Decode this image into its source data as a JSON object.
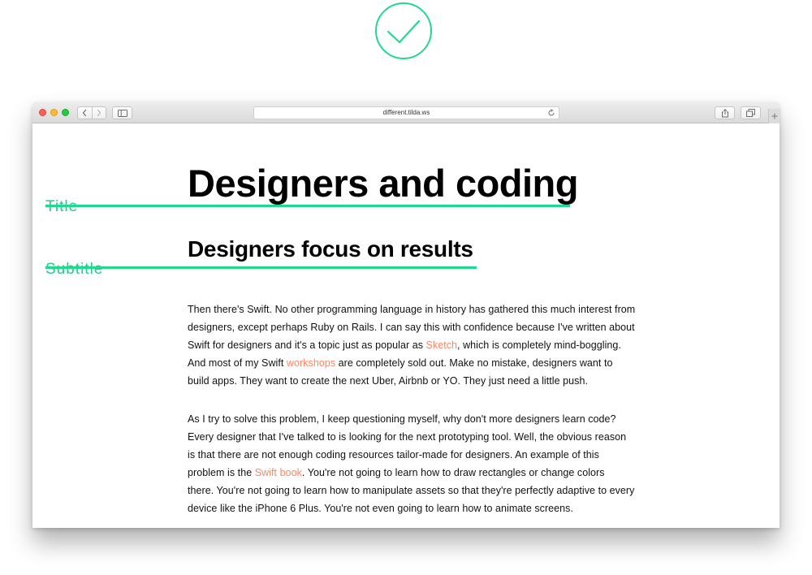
{
  "browser": {
    "url": "different.tilda.ws"
  },
  "page": {
    "title_label": "Title",
    "subtitle_label": "Subtitle",
    "title": "Designers and coding",
    "subtitle": "Designers focus on results",
    "paragraph1": {
      "line1": "Then there's Swift. No other programming language in history has gathered this much interest from",
      "line2": "designers, except perhaps Ruby on Rails. I can say this with confidence because I've written about",
      "line3_before": "Swift for designers and it's a topic just as popular as ",
      "line3_link": "Sketch",
      "line3_after": ", which is completely mind-boggling.",
      "line4_before": "And most of my Swift ",
      "line4_link": "workshops",
      "line4_after": " are completely sold out. Make no mistake, designers want to",
      "line5": "build apps. They want to create the next Uber, Airbnb or YO. They just need a little push."
    },
    "paragraph2": {
      "line1": "As I try to solve this problem, I keep questioning myself, why don't more designers learn code?",
      "line2": "Every designer that I've talked to is looking for the next prototyping tool. Well, the obvious reason",
      "line3": "is that there are not enough coding resources tailor-made for designers. An example of this",
      "line4_before": "problem is the ",
      "line4_link": "Swift book",
      "line4_after": ". You're not going to learn how to draw rectangles or change colors",
      "line5": "there. You're not going to learn how to manipulate assets so that they're perfectly adaptive to every",
      "line6": "device like the iPhone 6 Plus. You're not even going to learn how to animate screens."
    }
  },
  "colors": {
    "accent_green": "#1fd98f",
    "link_orange": "#ff8562"
  },
  "icons": {
    "top": "checkmark-circle-icon",
    "toolbar": [
      "chevron-left-icon",
      "chevron-right-icon",
      "sidebar-icon",
      "reload-icon",
      "share-icon",
      "tabs-icon",
      "plus-icon"
    ]
  }
}
